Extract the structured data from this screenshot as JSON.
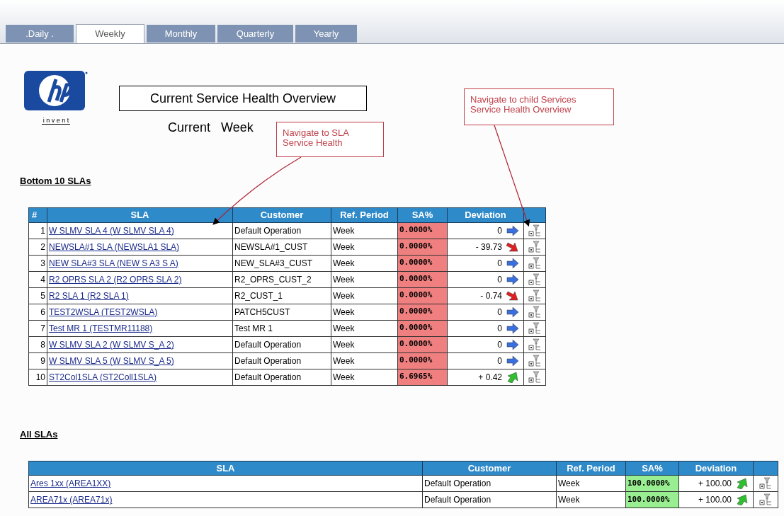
{
  "tabs": [
    {
      "label": ".Daily .",
      "selected": false
    },
    {
      "label": "Weekly",
      "selected": true
    },
    {
      "label": "Monthly",
      "selected": false
    },
    {
      "label": "Quarterly",
      "selected": false
    },
    {
      "label": "Yearly",
      "selected": false
    }
  ],
  "logo": {
    "tagline": "i n v e n t"
  },
  "title": "Current Service Health Overview",
  "subtitle": "Current   Week",
  "callouts": [
    "Navigate to SLA Service Health",
    "Navigate to child Services Service Health Overview"
  ],
  "bottom": {
    "heading": "Bottom 10 SLAs",
    "columns": [
      "#",
      "SLA",
      "Customer",
      "Ref. Period",
      "SA%",
      "Deviation"
    ],
    "rows": [
      {
        "num": "1",
        "sla": "W SLMV SLA 4 (W SLMV SLA 4)",
        "customer": "Default Operation",
        "period": "Week",
        "sa": {
          "text": "0.0000%",
          "color": "#f08080"
        },
        "deviation": {
          "text": "0",
          "kind": "flat"
        }
      },
      {
        "num": "2",
        "sla": "NEWSLA#1 SLA (NEWSLA1 SLA)",
        "customer": "NEWSLA#1_CUST",
        "period": "Week",
        "sa": {
          "text": "0.0000%",
          "color": "#f08080"
        },
        "deviation": {
          "text": "- 39.73",
          "kind": "down"
        }
      },
      {
        "num": "3",
        "sla": "NEW SLA#3 SLA (NEW S A3 S A)",
        "customer": "NEW_SLA#3_CUST",
        "period": "Week",
        "sa": {
          "text": "0.0000%",
          "color": "#f08080"
        },
        "deviation": {
          "text": "0",
          "kind": "flat"
        }
      },
      {
        "num": "4",
        "sla": "R2 OPRS SLA 2 (R2 OPRS SLA 2)",
        "customer": "R2_OPRS_CUST_2",
        "period": "Week",
        "sa": {
          "text": "0.0000%",
          "color": "#f08080"
        },
        "deviation": {
          "text": "0",
          "kind": "flat"
        }
      },
      {
        "num": "5",
        "sla": "R2 SLA 1 (R2 SLA 1)",
        "customer": "R2_CUST_1",
        "period": "Week",
        "sa": {
          "text": "0.0000%",
          "color": "#f08080"
        },
        "deviation": {
          "text": "- 0.74",
          "kind": "down"
        }
      },
      {
        "num": "6",
        "sla": "TEST2WSLA (TEST2WSLA)",
        "customer": "PATCH5CUST",
        "period": "Week",
        "sa": {
          "text": "0.0000%",
          "color": "#f08080"
        },
        "deviation": {
          "text": "0",
          "kind": "flat"
        }
      },
      {
        "num": "7",
        "sla": "Test MR 1 (TESTMR11188)",
        "customer": "Test MR 1",
        "period": "Week",
        "sa": {
          "text": "0.0000%",
          "color": "#f08080"
        },
        "deviation": {
          "text": "0",
          "kind": "flat"
        }
      },
      {
        "num": "8",
        "sla": "W SLMV SLA 2 (W SLMV S_A 2)",
        "customer": "Default Operation",
        "period": "Week",
        "sa": {
          "text": "0.0000%",
          "color": "#f08080"
        },
        "deviation": {
          "text": "0",
          "kind": "flat"
        }
      },
      {
        "num": "9",
        "sla": "W SLMV SLA 5 (W SLMV S_A 5)",
        "customer": "Default Operation",
        "period": "Week",
        "sa": {
          "text": "0.0000%",
          "color": "#f08080"
        },
        "deviation": {
          "text": "0",
          "kind": "flat"
        }
      },
      {
        "num": "10",
        "sla": "ST2Col1SLA (ST2Coll1SLA)",
        "customer": "Default Operation",
        "period": "Week",
        "sa": {
          "text": "6.6965%",
          "color": "#f08080"
        },
        "deviation": {
          "text": "+ 0.42",
          "kind": "up"
        }
      }
    ]
  },
  "all": {
    "heading": "All SLAs",
    "columns": [
      "SLA",
      "Customer",
      "Ref. Period",
      "SA%",
      "Deviation"
    ],
    "rows": [
      {
        "sla": "Ares 1xx (AREA1XX)",
        "customer": "Default Operation",
        "period": "Week",
        "sa": {
          "text": "100.0000%",
          "color": "#98ee90"
        },
        "deviation": {
          "text": "+ 100.00",
          "kind": "up"
        }
      },
      {
        "sla": "AREA71x (AREA71x)",
        "customer": "Default Operation",
        "period": "Week",
        "sa": {
          "text": "100.0000%",
          "color": "#98ee90"
        },
        "deviation": {
          "text": "+ 100.00",
          "kind": "up"
        }
      }
    ]
  }
}
